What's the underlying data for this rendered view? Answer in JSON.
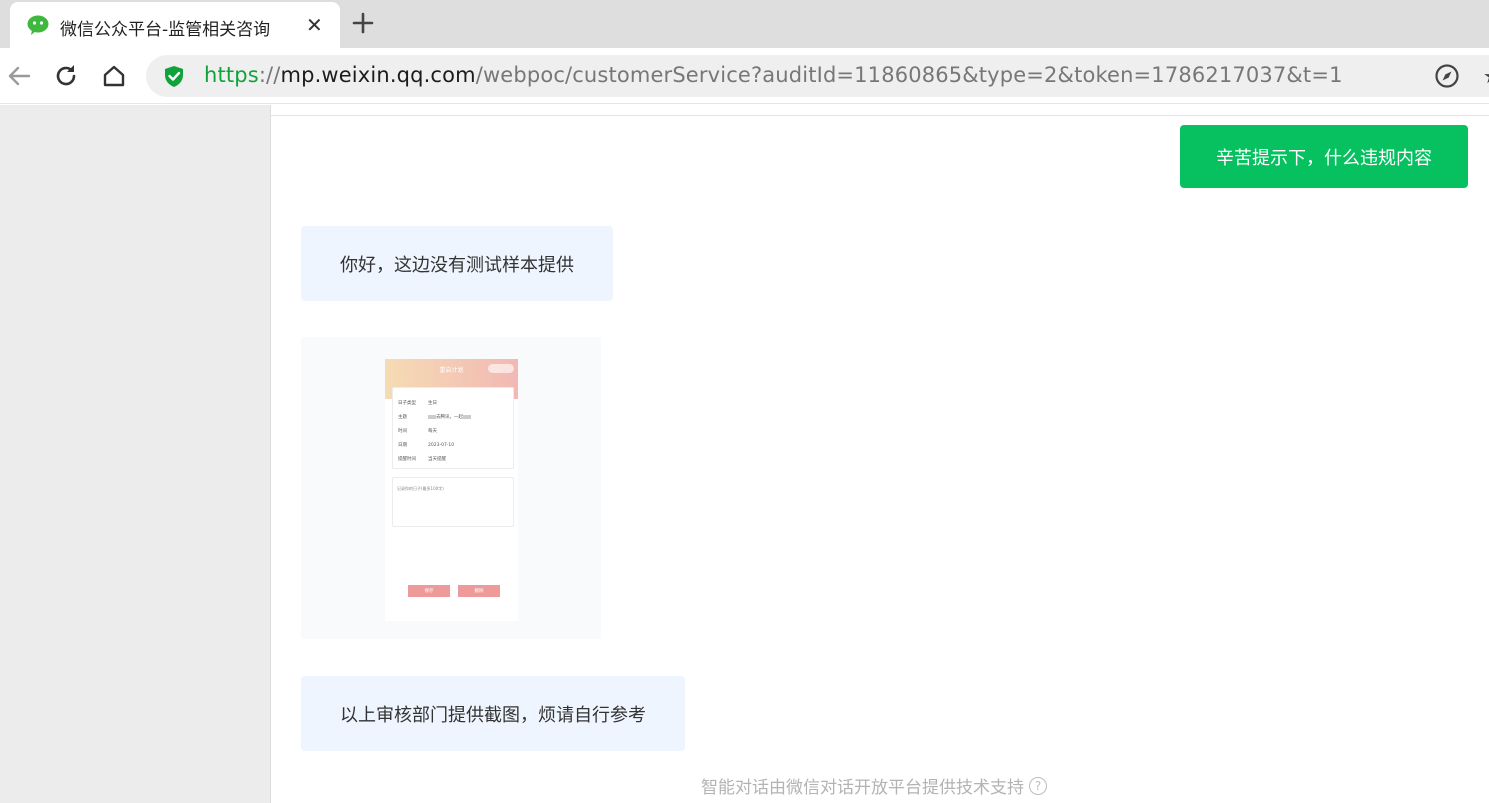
{
  "browser": {
    "tab": {
      "title": "微信公众平台-监管相关咨询",
      "close_glyph": "✕",
      "favicon": "wechat-icon"
    },
    "new_tab_icon": "plus-icon",
    "nav_icons": [
      "back-arrow-icon",
      "reload-icon",
      "home-icon"
    ],
    "address": {
      "scheme": "https",
      "separator": "://",
      "host": "mp.weixin.qq.com",
      "path": "/webpoc/customerService?auditId=11860865&type=2&token=1786217037&t=1",
      "secure_icon": "shield-check-icon"
    },
    "right_icons": [
      "compass-icon",
      "star-icon"
    ]
  },
  "colors": {
    "accent": "#07c160",
    "bot_bubble": "#eef5fe",
    "secure": "#11a33b"
  },
  "chat": {
    "messages": [
      {
        "from": "user",
        "text": "辛苦提示下，什么违规内容"
      },
      {
        "from": "bot",
        "text": "你好，这边没有测试样本提供"
      },
      {
        "from": "bot",
        "type": "image",
        "screenshot": {
          "title": "重启计划",
          "rows": [
            {
              "k": "日子类型",
              "v": "生日"
            },
            {
              "k": "主题",
              "v": "去腾讯，一起"
            },
            {
              "k": "时间",
              "v": "每天"
            },
            {
              "k": "日期",
              "v": "2023-07-10"
            },
            {
              "k": "提醒时间",
              "v": "当天提醒"
            }
          ],
          "note": "记录你的日子(最多100字)",
          "buttons": [
            "保存",
            "删除"
          ]
        }
      },
      {
        "from": "bot",
        "text": "以上审核部门提供截图，烦请自行参考"
      }
    ]
  },
  "footer": {
    "text": "智能对话由微信对话开放平台提供技术支持",
    "help_glyph": "?"
  }
}
